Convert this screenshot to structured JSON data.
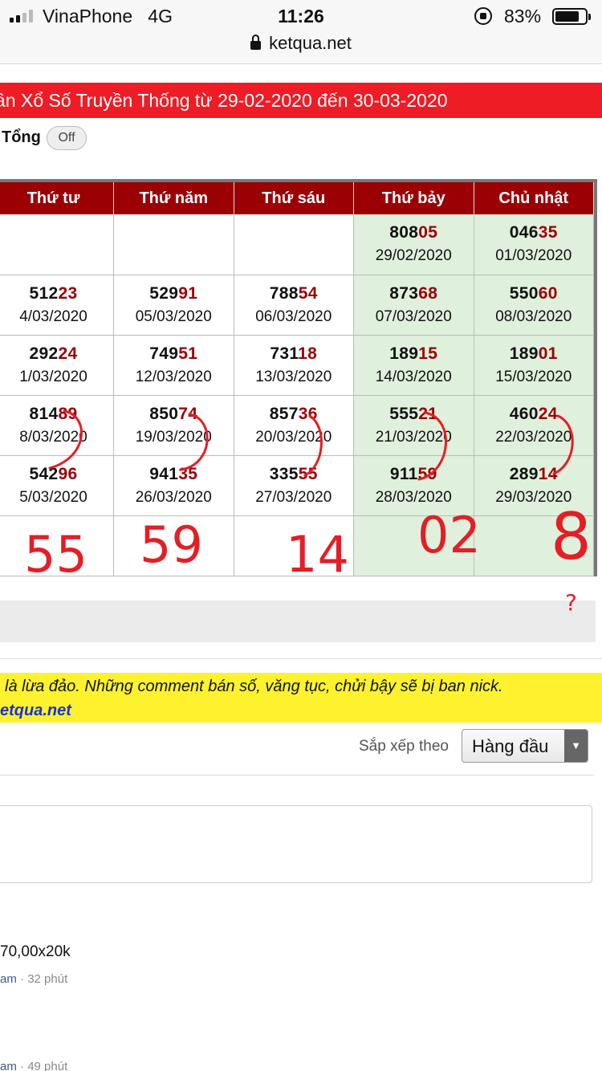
{
  "status_bar": {
    "carrier": "VinaPhone",
    "network": "4G",
    "time": "11:26",
    "battery": "83%"
  },
  "browser": {
    "url": "ketqua.net"
  },
  "banner": {
    "title": "ần Xổ Số Truyền Thống từ 29-02-2020 đến 30-03-2020"
  },
  "toggle": {
    "label": "Tổng",
    "state": "Off"
  },
  "table": {
    "headers": [
      "Thứ tư",
      "Thứ năm",
      "Thứ sáu",
      "Thứ bảy",
      "Chủ nhật"
    ],
    "rows": [
      [
        {
          "head": "",
          "tail": "",
          "date": ""
        },
        {
          "head": "",
          "tail": "",
          "date": ""
        },
        {
          "head": "",
          "tail": "",
          "date": ""
        },
        {
          "head": "808",
          "tail": "05",
          "date": "29/02/2020"
        },
        {
          "head": "046",
          "tail": "35",
          "date": "01/03/2020"
        }
      ],
      [
        {
          "head": "512",
          "tail": "23",
          "date": "4/03/2020"
        },
        {
          "head": "529",
          "tail": "91",
          "date": "05/03/2020"
        },
        {
          "head": "788",
          "tail": "54",
          "date": "06/03/2020"
        },
        {
          "head": "873",
          "tail": "68",
          "date": "07/03/2020"
        },
        {
          "head": "550",
          "tail": "60",
          "date": "08/03/2020"
        }
      ],
      [
        {
          "head": "292",
          "tail": "24",
          "date": "1/03/2020"
        },
        {
          "head": "749",
          "tail": "51",
          "date": "12/03/2020"
        },
        {
          "head": "731",
          "tail": "18",
          "date": "13/03/2020"
        },
        {
          "head": "189",
          "tail": "15",
          "date": "14/03/2020"
        },
        {
          "head": "189",
          "tail": "01",
          "date": "15/03/2020"
        }
      ],
      [
        {
          "head": "814",
          "tail": "89",
          "date": "8/03/2020"
        },
        {
          "head": "850",
          "tail": "74",
          "date": "19/03/2020"
        },
        {
          "head": "857",
          "tail": "36",
          "date": "20/03/2020"
        },
        {
          "head": "555",
          "tail": "21",
          "date": "21/03/2020"
        },
        {
          "head": "460",
          "tail": "24",
          "date": "22/03/2020"
        }
      ],
      [
        {
          "head": "542",
          "tail": "96",
          "date": "5/03/2020"
        },
        {
          "head": "941",
          "tail": "35",
          "date": "26/03/2020"
        },
        {
          "head": "335",
          "tail": "55",
          "date": "27/03/2020"
        },
        {
          "head": "911",
          "tail": "59",
          "date": "28/03/2020"
        },
        {
          "head": "289",
          "tail": "14",
          "date": "29/03/2020"
        }
      ]
    ]
  },
  "handwriting": {
    "col1": "55",
    "col2": "59",
    "col3": "14",
    "col4": "02",
    "col5": "8",
    "mark": "?"
  },
  "notice": {
    "line1": "là lừa đảo. Những comment bán số, văng tục, chửi bậy sẽ bị ban nick.",
    "line2": "etqua.net"
  },
  "comments": {
    "sort_label": "Sắp xếp theo",
    "sort_value": "Hàng đầu",
    "items": [
      {
        "text": "70,00x20k",
        "author": "am",
        "time": "32 phút"
      },
      {
        "text": "",
        "author": "am",
        "time": "49 phút"
      }
    ]
  },
  "colors": {
    "banner": "#ee1c25",
    "header": "#9b0005",
    "weekend": "#dff0dc",
    "notice": "#fdf22d",
    "ink": "#e41e26"
  }
}
